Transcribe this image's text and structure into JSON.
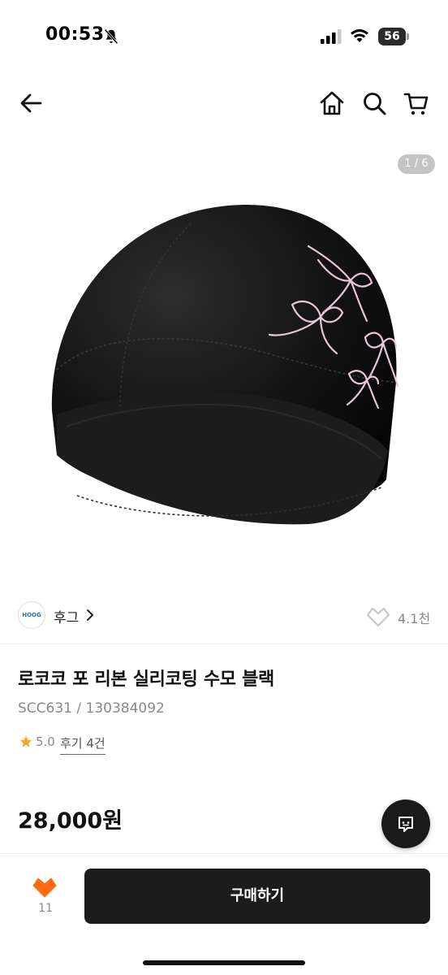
{
  "status_bar": {
    "time": "00:53",
    "battery": "56",
    "icons": [
      "bell-muted-icon",
      "signal-icon",
      "wifi-icon",
      "battery-icon"
    ]
  },
  "header": {
    "icons": [
      "back-arrow-icon",
      "home-icon",
      "search-icon",
      "cart-icon"
    ]
  },
  "gallery": {
    "counter": "1 / 6",
    "image": "black swim cap with pink ribbon print"
  },
  "brand": {
    "name": "후그",
    "logo_text": "HOOG",
    "wish_count": "4.1천"
  },
  "product": {
    "name": "로코코 포 리본 실리코팅 수모 블랙",
    "code": "SCC631 / 130384092",
    "rating": "5.0",
    "review_link": "후기 4건",
    "price": "28,000원"
  },
  "bottom_bar": {
    "like_count": "11",
    "buy_label": "구매하기"
  },
  "colors": {
    "accent": "#ff6a13",
    "star": "#f5a623",
    "button": "#1c1c1c",
    "muted": "#8a8a8a"
  }
}
